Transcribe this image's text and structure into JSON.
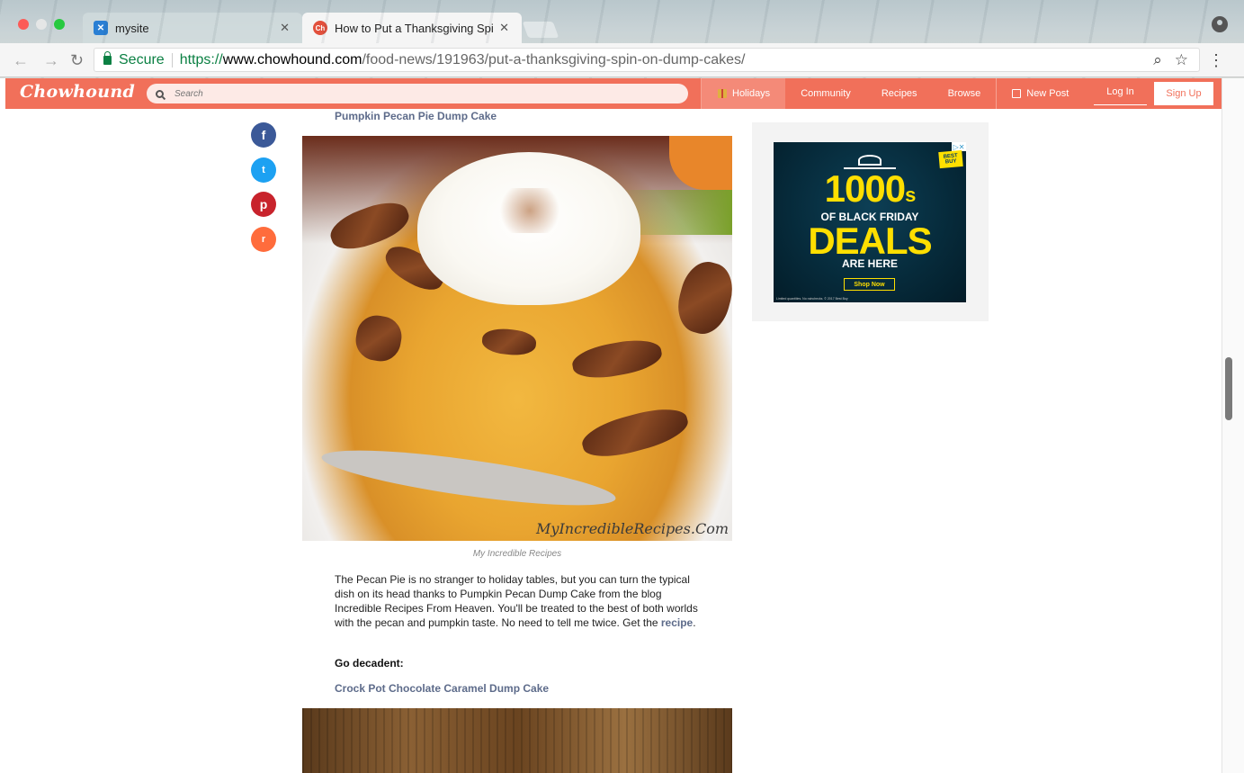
{
  "browser": {
    "tabs": [
      {
        "title": "mysite",
        "favicon": "x-favicon",
        "active": false
      },
      {
        "title": "How to Put a Thanksgiving Spi",
        "favicon": "chowhound-favicon",
        "active": true
      }
    ],
    "secure_label": "Secure",
    "url_scheme": "https://",
    "url_host": "www.chowhound.com",
    "url_path": "/food-news/191963/put-a-thanksgiving-spin-on-dump-cakes/"
  },
  "site": {
    "logo": "Chowhound",
    "search_placeholder": "Search",
    "nav": {
      "holidays": "Holidays",
      "community": "Community",
      "recipes": "Recipes",
      "browse": "Browse",
      "new_post": "New Post",
      "log_in": "Log In",
      "sign_up": "Sign Up"
    },
    "accent_color": "#f1705a"
  },
  "article": {
    "heading": "Pumpkin Pecan Pie Dump Cake",
    "image_watermark": "MyIncredibleRecipes.Com",
    "caption": "My Incredible Recipes",
    "paragraph": "The Pecan Pie is no stranger to holiday tables, but you can turn the typical dish on its head thanks to Pumpkin Pecan Dump Cake from the blog Incredible Recipes From Heaven. You'll be treated to the best of both worlds with the pecan and pumpkin taste. No need to tell me twice. Get the ",
    "paragraph_link": "recipe",
    "paragraph_end": ".",
    "subhead": "Go decadent:",
    "next_heading": "Crock Pot Chocolate Caramel Dump Cake"
  },
  "social": {
    "facebook": "f",
    "twitter": "t",
    "pinterest": "p",
    "reddit": "r"
  },
  "ad": {
    "badge": "BEST BUY",
    "big": "1000",
    "big_suffix": "s",
    "line1": "OF BLACK FRIDAY",
    "deals": "DEALS",
    "line2": "ARE HERE",
    "cta": "Shop Now",
    "fine_print": "Limited quantities. No rainchecks. © 2017 Best Buy"
  }
}
